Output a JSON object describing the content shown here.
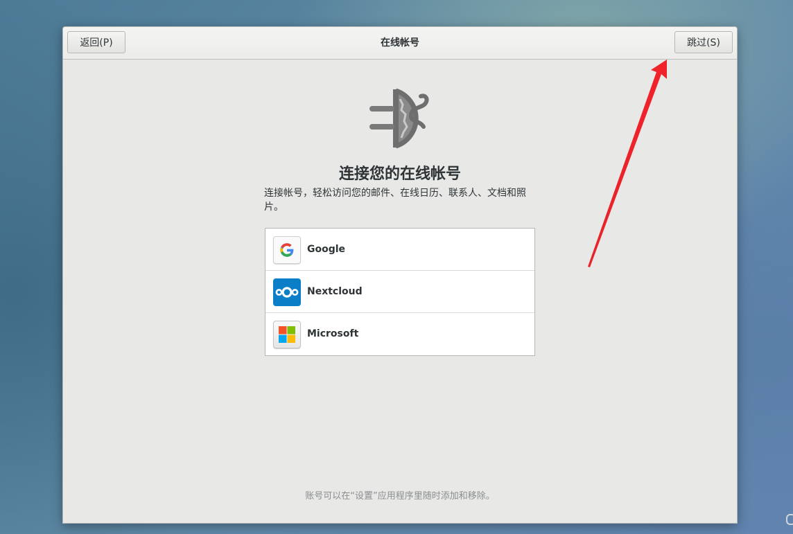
{
  "window": {
    "title": "在线帐号",
    "back_label": "返回(P)",
    "skip_label": "跳过(S)"
  },
  "main": {
    "hero_icon": "online-accounts-icon",
    "heading": "连接您的在线帐号",
    "description": "连接帐号，轻松访问您的邮件、在线日历、联系人、文档和照片。",
    "providers": [
      {
        "label": "Google",
        "icon": "google-icon"
      },
      {
        "label": "Nextcloud",
        "icon": "nextcloud-icon"
      },
      {
        "label": "Microsoft",
        "icon": "microsoft-icon"
      }
    ],
    "footer_note": "账号可以在“设置”应用程序里随时添加和移除。"
  },
  "annotation": {
    "type": "arrow",
    "color": "#e8232a",
    "points_to": "skip-button"
  }
}
